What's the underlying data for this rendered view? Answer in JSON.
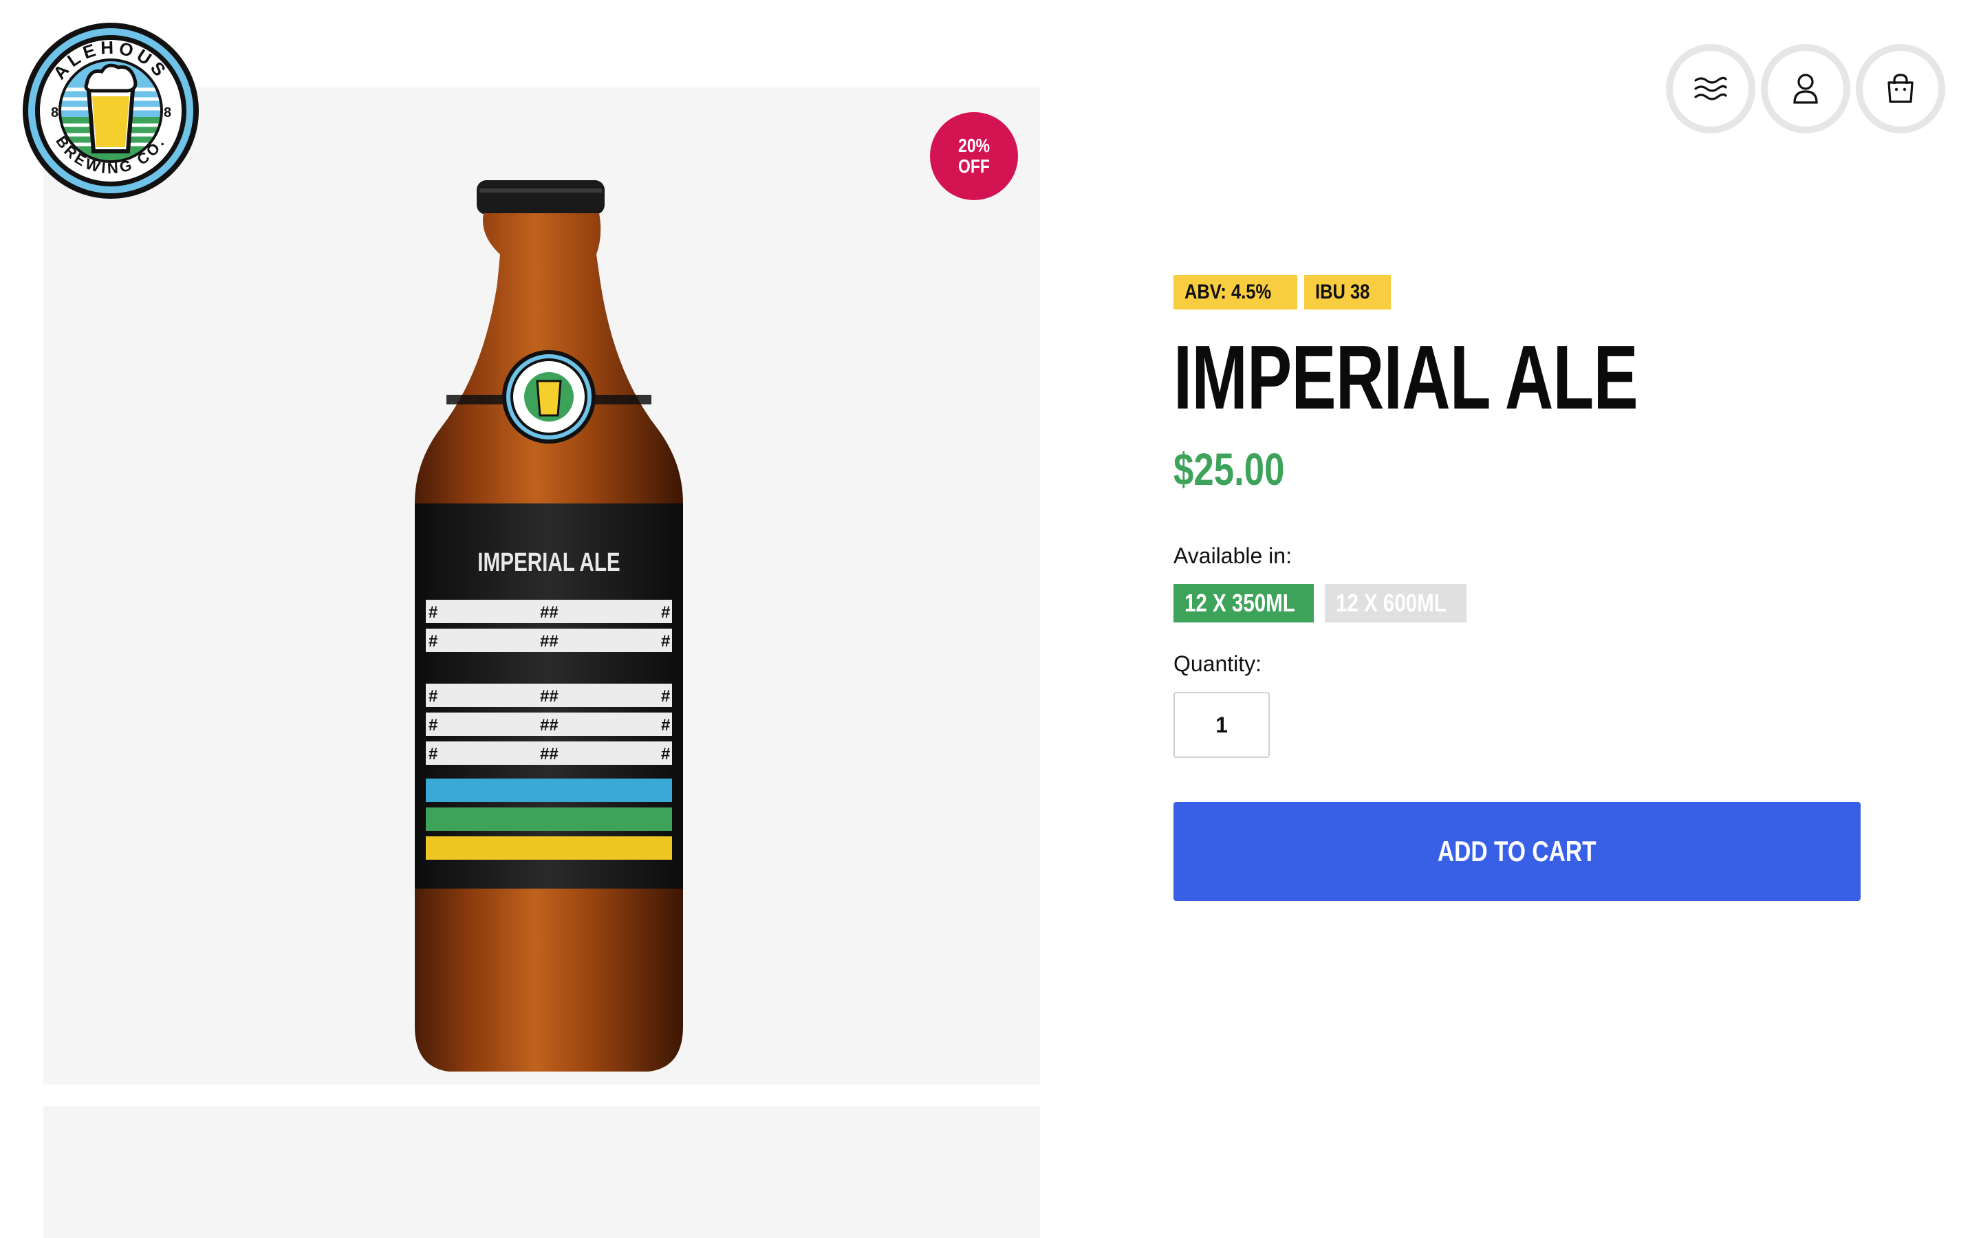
{
  "logo": {
    "name": "ALEHOUS BREWING CO.",
    "top_text": "ALEHOUS",
    "bottom_text": "BREWING CO.",
    "side_left": "8",
    "side_right": "8"
  },
  "header": {
    "icons": [
      {
        "name": "menu-icon",
        "label": "Menu"
      },
      {
        "name": "user-icon",
        "label": "Account"
      },
      {
        "name": "cart-icon",
        "label": "Cart"
      }
    ]
  },
  "media": {
    "discount_line1": "20%",
    "discount_line2": "OFF",
    "bottle_label": "IMPERIAL ALE",
    "label_placeholder": "##"
  },
  "product": {
    "tags": [
      "ABV: 4.5%",
      "IBU 38"
    ],
    "title": "IMPERIAL ALE",
    "price": "$25.00",
    "available_label": "Available in:",
    "sizes": [
      {
        "label": "12 X 350ML",
        "selected": true
      },
      {
        "label": "12 X 600ML",
        "selected": false
      }
    ],
    "quantity_label": "Quantity:",
    "quantity": "1",
    "add_to_cart": "ADD TO CART"
  },
  "colors": {
    "discount": "#d31352",
    "price": "#3ea35a",
    "tag": "#f8cd3f",
    "button": "#3860e6",
    "size_active": "#3ea35a",
    "size_inactive": "#e0e0e0"
  }
}
